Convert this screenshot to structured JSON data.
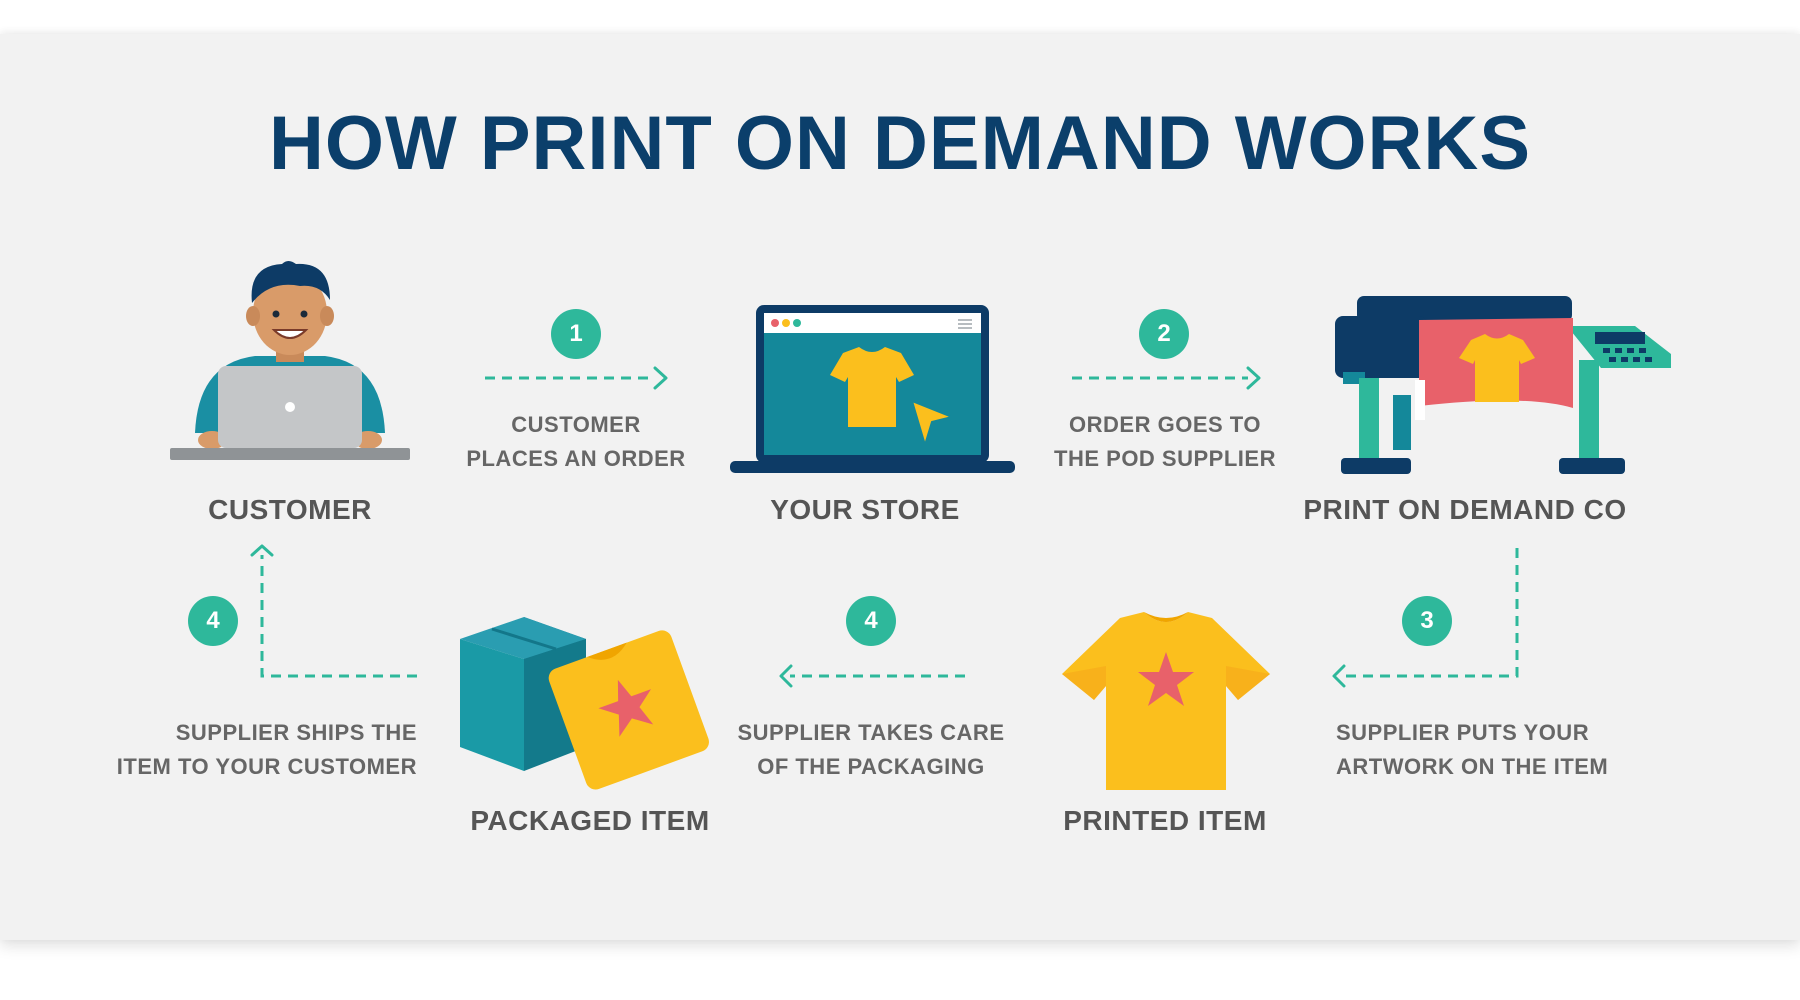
{
  "title": "HOW PRINT ON DEMAND WORKS",
  "nodes": {
    "customer": "CUSTOMER",
    "store": "YOUR STORE",
    "pod": "PRINT ON DEMAND CO",
    "printed": "PRINTED ITEM",
    "packaged": "PACKAGED ITEM"
  },
  "steps": [
    {
      "number": "1",
      "line1": "CUSTOMER",
      "line2": "PLACES AN ORDER"
    },
    {
      "number": "2",
      "line1": "ORDER GOES TO",
      "line2": "THE POD SUPPLIER"
    },
    {
      "number": "3",
      "line1": "SUPPLIER PUTS YOUR",
      "line2": "ARTWORK ON THE ITEM"
    },
    {
      "number": "4",
      "line1": "SUPPLIER TAKES CARE",
      "line2": "OF THE PACKAGING"
    },
    {
      "number": "4",
      "line1": "SUPPLIER SHIPS THE",
      "line2": "ITEM TO YOUR CUSTOMER"
    }
  ],
  "colors": {
    "title": "#0b3f6b",
    "teal_accent": "#2eb89b",
    "shirt_yellow": "#fbbf1d",
    "star_red": "#e8616a",
    "screen_teal": "#14889a"
  },
  "icons": [
    "customer-illustration",
    "store-laptop-illustration",
    "printer-illustration",
    "printed-tshirt-illustration",
    "packaged-item-illustration"
  ]
}
